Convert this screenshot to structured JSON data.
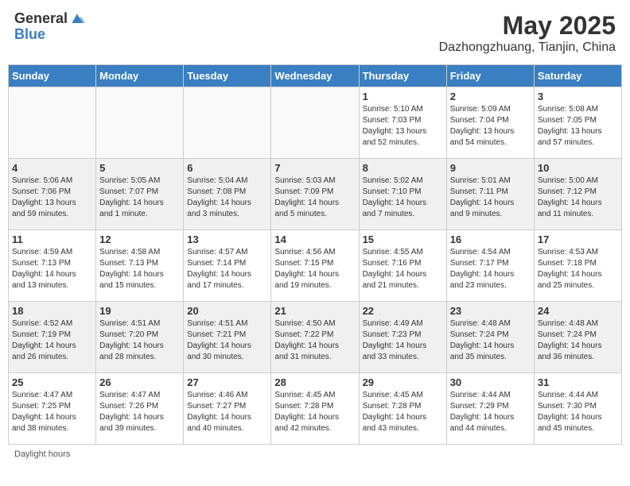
{
  "logo": {
    "general": "General",
    "blue": "Blue"
  },
  "header": {
    "month": "May 2025",
    "location": "Dazhongzhuang, Tianjin, China"
  },
  "days_of_week": [
    "Sunday",
    "Monday",
    "Tuesday",
    "Wednesday",
    "Thursday",
    "Friday",
    "Saturday"
  ],
  "weeks": [
    {
      "shaded": false,
      "days": [
        {
          "num": "",
          "info": ""
        },
        {
          "num": "",
          "info": ""
        },
        {
          "num": "",
          "info": ""
        },
        {
          "num": "",
          "info": ""
        },
        {
          "num": "1",
          "info": "Sunrise: 5:10 AM\nSunset: 7:03 PM\nDaylight: 13 hours\nand 52 minutes."
        },
        {
          "num": "2",
          "info": "Sunrise: 5:09 AM\nSunset: 7:04 PM\nDaylight: 13 hours\nand 54 minutes."
        },
        {
          "num": "3",
          "info": "Sunrise: 5:08 AM\nSunset: 7:05 PM\nDaylight: 13 hours\nand 57 minutes."
        }
      ]
    },
    {
      "shaded": true,
      "days": [
        {
          "num": "4",
          "info": "Sunrise: 5:06 AM\nSunset: 7:06 PM\nDaylight: 13 hours\nand 59 minutes."
        },
        {
          "num": "5",
          "info": "Sunrise: 5:05 AM\nSunset: 7:07 PM\nDaylight: 14 hours\nand 1 minute."
        },
        {
          "num": "6",
          "info": "Sunrise: 5:04 AM\nSunset: 7:08 PM\nDaylight: 14 hours\nand 3 minutes."
        },
        {
          "num": "7",
          "info": "Sunrise: 5:03 AM\nSunset: 7:09 PM\nDaylight: 14 hours\nand 5 minutes."
        },
        {
          "num": "8",
          "info": "Sunrise: 5:02 AM\nSunset: 7:10 PM\nDaylight: 14 hours\nand 7 minutes."
        },
        {
          "num": "9",
          "info": "Sunrise: 5:01 AM\nSunset: 7:11 PM\nDaylight: 14 hours\nand 9 minutes."
        },
        {
          "num": "10",
          "info": "Sunrise: 5:00 AM\nSunset: 7:12 PM\nDaylight: 14 hours\nand 11 minutes."
        }
      ]
    },
    {
      "shaded": false,
      "days": [
        {
          "num": "11",
          "info": "Sunrise: 4:59 AM\nSunset: 7:13 PM\nDaylight: 14 hours\nand 13 minutes."
        },
        {
          "num": "12",
          "info": "Sunrise: 4:58 AM\nSunset: 7:13 PM\nDaylight: 14 hours\nand 15 minutes."
        },
        {
          "num": "13",
          "info": "Sunrise: 4:57 AM\nSunset: 7:14 PM\nDaylight: 14 hours\nand 17 minutes."
        },
        {
          "num": "14",
          "info": "Sunrise: 4:56 AM\nSunset: 7:15 PM\nDaylight: 14 hours\nand 19 minutes."
        },
        {
          "num": "15",
          "info": "Sunrise: 4:55 AM\nSunset: 7:16 PM\nDaylight: 14 hours\nand 21 minutes."
        },
        {
          "num": "16",
          "info": "Sunrise: 4:54 AM\nSunset: 7:17 PM\nDaylight: 14 hours\nand 23 minutes."
        },
        {
          "num": "17",
          "info": "Sunrise: 4:53 AM\nSunset: 7:18 PM\nDaylight: 14 hours\nand 25 minutes."
        }
      ]
    },
    {
      "shaded": true,
      "days": [
        {
          "num": "18",
          "info": "Sunrise: 4:52 AM\nSunset: 7:19 PM\nDaylight: 14 hours\nand 26 minutes."
        },
        {
          "num": "19",
          "info": "Sunrise: 4:51 AM\nSunset: 7:20 PM\nDaylight: 14 hours\nand 28 minutes."
        },
        {
          "num": "20",
          "info": "Sunrise: 4:51 AM\nSunset: 7:21 PM\nDaylight: 14 hours\nand 30 minutes."
        },
        {
          "num": "21",
          "info": "Sunrise: 4:50 AM\nSunset: 7:22 PM\nDaylight: 14 hours\nand 31 minutes."
        },
        {
          "num": "22",
          "info": "Sunrise: 4:49 AM\nSunset: 7:23 PM\nDaylight: 14 hours\nand 33 minutes."
        },
        {
          "num": "23",
          "info": "Sunrise: 4:48 AM\nSunset: 7:24 PM\nDaylight: 14 hours\nand 35 minutes."
        },
        {
          "num": "24",
          "info": "Sunrise: 4:48 AM\nSunset: 7:24 PM\nDaylight: 14 hours\nand 36 minutes."
        }
      ]
    },
    {
      "shaded": false,
      "days": [
        {
          "num": "25",
          "info": "Sunrise: 4:47 AM\nSunset: 7:25 PM\nDaylight: 14 hours\nand 38 minutes."
        },
        {
          "num": "26",
          "info": "Sunrise: 4:47 AM\nSunset: 7:26 PM\nDaylight: 14 hours\nand 39 minutes."
        },
        {
          "num": "27",
          "info": "Sunrise: 4:46 AM\nSunset: 7:27 PM\nDaylight: 14 hours\nand 40 minutes."
        },
        {
          "num": "28",
          "info": "Sunrise: 4:45 AM\nSunset: 7:28 PM\nDaylight: 14 hours\nand 42 minutes."
        },
        {
          "num": "29",
          "info": "Sunrise: 4:45 AM\nSunset: 7:28 PM\nDaylight: 14 hours\nand 43 minutes."
        },
        {
          "num": "30",
          "info": "Sunrise: 4:44 AM\nSunset: 7:29 PM\nDaylight: 14 hours\nand 44 minutes."
        },
        {
          "num": "31",
          "info": "Sunrise: 4:44 AM\nSunset: 7:30 PM\nDaylight: 14 hours\nand 45 minutes."
        }
      ]
    }
  ],
  "footer": {
    "label": "Daylight hours"
  }
}
